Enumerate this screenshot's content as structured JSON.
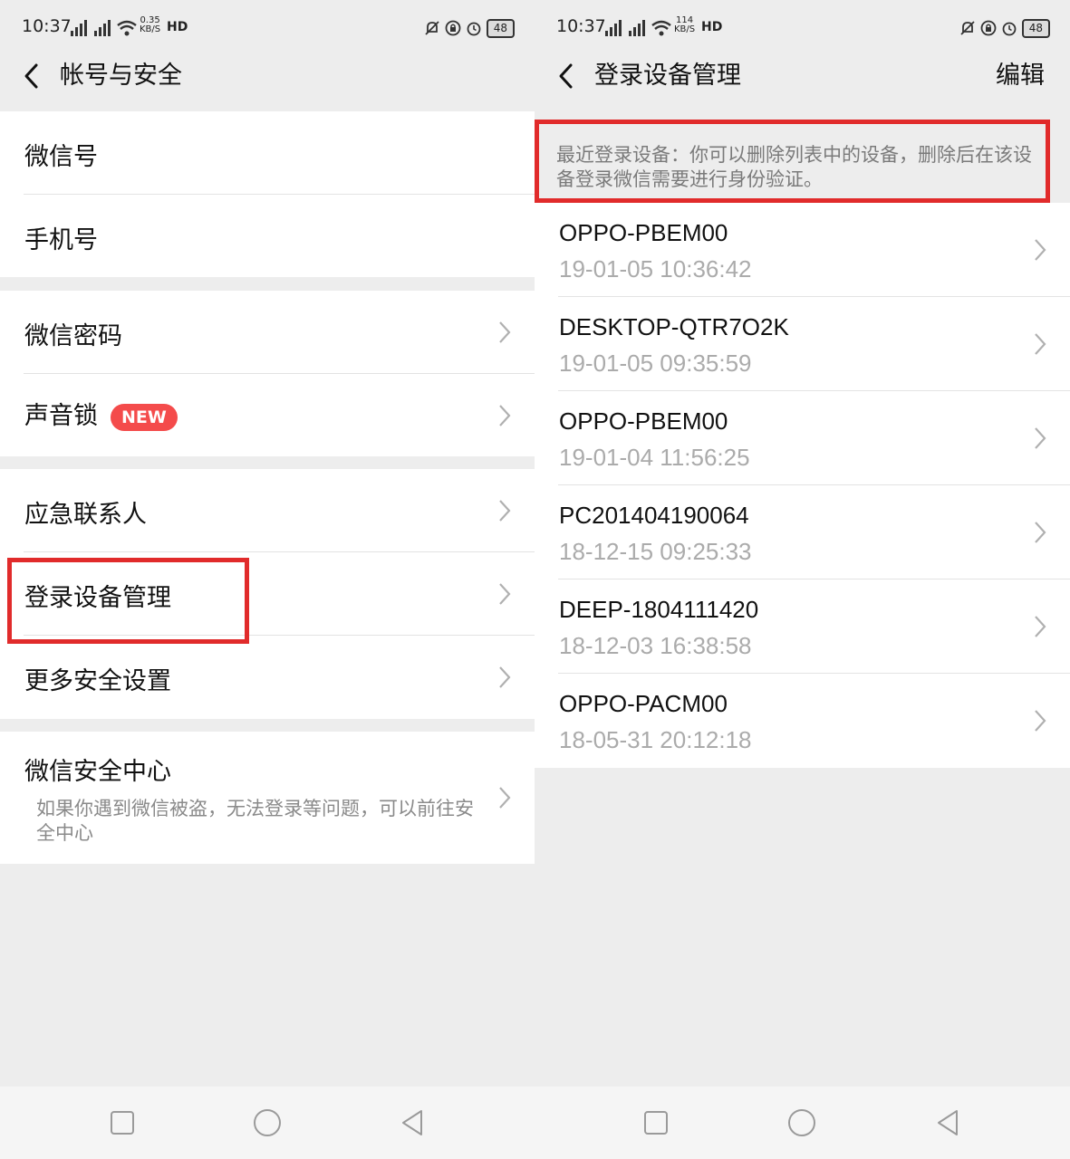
{
  "left": {
    "status": {
      "time": "10:37",
      "net_top": "0.35",
      "net_bottom": "KB/S",
      "hd": "HD",
      "battery": "48"
    },
    "nav": {
      "title": "帐号与安全"
    },
    "items": [
      {
        "label": "微信号"
      },
      {
        "label": "手机号"
      },
      {
        "label": "微信密码"
      },
      {
        "label": "声音锁",
        "badge": "NEW"
      },
      {
        "label": "应急联系人"
      },
      {
        "label": "登录设备管理"
      },
      {
        "label": "更多安全设置"
      },
      {
        "label": "微信安全中心",
        "sub": "如果你遇到微信被盗，无法登录等问题，可以前往安全中心"
      }
    ]
  },
  "right": {
    "status": {
      "time": "10:37",
      "net_top": "114",
      "net_bottom": "KB/S",
      "hd": "HD",
      "battery": "48"
    },
    "nav": {
      "title": "登录设备管理",
      "action": "编辑"
    },
    "notice": "最近登录设备：你可以删除列表中的设备，删除后在该设备登录微信需要进行身份验证。",
    "devices": [
      {
        "name": "OPPO-PBEM00",
        "time": "19-01-05 10:36:42"
      },
      {
        "name": "DESKTOP-QTR7O2K",
        "time": "19-01-05 09:35:59"
      },
      {
        "name": "OPPO-PBEM00",
        "time": "19-01-04 11:56:25"
      },
      {
        "name": "PC201404190064",
        "time": "18-12-15 09:25:33"
      },
      {
        "name": "DEEP-1804111420",
        "time": "18-12-03 16:38:58"
      },
      {
        "name": "OPPO-PACM00",
        "time": "18-05-31 20:12:18"
      }
    ]
  },
  "colors": {
    "highlight": "#e12b2b",
    "badge": "#f44b4b",
    "background": "#ededed"
  },
  "icons": [
    "back-arrow-icon",
    "chevron-right-icon",
    "signal-icon",
    "wifi-icon",
    "mute-icon",
    "lock-icon",
    "alarm-icon",
    "battery-icon",
    "square-nav-icon",
    "circle-nav-icon",
    "triangle-nav-icon"
  ]
}
